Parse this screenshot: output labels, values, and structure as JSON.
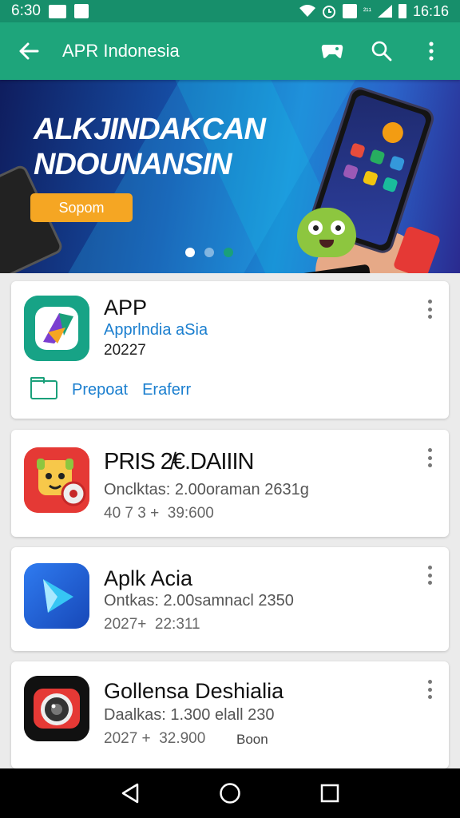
{
  "status_bar": {
    "time": "6:30",
    "signal_text": "²¹¹",
    "battery_time": "16:16"
  },
  "app_bar": {
    "title": "APR Indonesia"
  },
  "banner": {
    "headline_line1": "ALKJINDAKCAN",
    "headline_line2": "NDOUNANSIN",
    "cta_label": "Sopom",
    "page_indicator": {
      "count": 3,
      "active_index": 0
    }
  },
  "apps": [
    {
      "name": "APP",
      "subtitle": "Apprlndia aSia",
      "year": "20227",
      "action_primary": "Prepoat",
      "action_secondary": "Eraferr"
    },
    {
      "name": "PRIS 2̸€.DAIIIN",
      "line1": "Onclktas: 2.00oraman 2631g",
      "line2": "40 7 3 +  39:600"
    },
    {
      "name": "Aplk Acia",
      "line1": "Ontkas: 2.00samnacl 2350",
      "line2": "2027+  22:311"
    },
    {
      "name": "Gollensa Deshialia",
      "line1": "Daalkas: 1.300 elall 230",
      "line2": "2027 +  32.900",
      "extra": "Boon"
    }
  ],
  "colors": {
    "status_bar": "#178f6b",
    "app_bar": "#1ea57b",
    "link": "#1b7fcf"
  },
  "icons": [
    "back-arrow-icon",
    "game-controller-icon",
    "search-icon",
    "more-vert-icon"
  ]
}
